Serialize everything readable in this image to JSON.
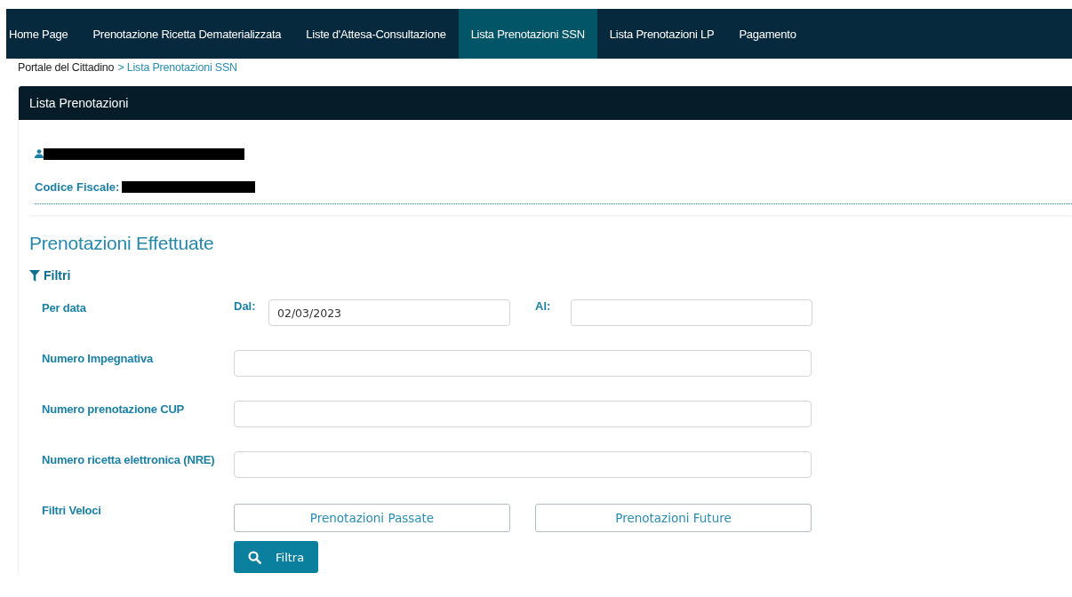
{
  "nav": [
    {
      "label": "Home Page",
      "selected": false
    },
    {
      "label": "Prenotazione Ricetta Dematerializzata",
      "selected": false
    },
    {
      "label": "Liste d'Attesa-Consultazione",
      "selected": false
    },
    {
      "label": "Lista Prenotazioni SSN",
      "selected": true
    },
    {
      "label": "Lista Prenotazioni LP",
      "selected": false
    },
    {
      "label": "Pagamento",
      "selected": false
    }
  ],
  "breadcrumb": {
    "root": "Portale del Cittadino",
    "current": "> Lista Prenotazioni SSN"
  },
  "panel": {
    "title": "Lista Prenotazioni"
  },
  "user": {
    "codice_fiscale_label": "Codice Fiscale:"
  },
  "section_title": "Prenotazioni Effettuate",
  "filters_label": "Filtri",
  "rows": [
    {
      "kind": "date_range",
      "label": "Per data",
      "from_label": "Dal:",
      "from_value": "02/03/2023",
      "to_label": "Al:"
    },
    {
      "kind": "text",
      "label": "Numero Impegnativa"
    },
    {
      "kind": "text",
      "label": "Numero prenotazione CUP"
    },
    {
      "kind": "text",
      "label": "Numero ricetta elettronica (NRE)"
    },
    {
      "kind": "buttons",
      "label": "Filtri Veloci",
      "buttons": [
        "Prenotazioni Passate",
        "Prenotazioni Future"
      ]
    }
  ],
  "submit": "Filtra"
}
